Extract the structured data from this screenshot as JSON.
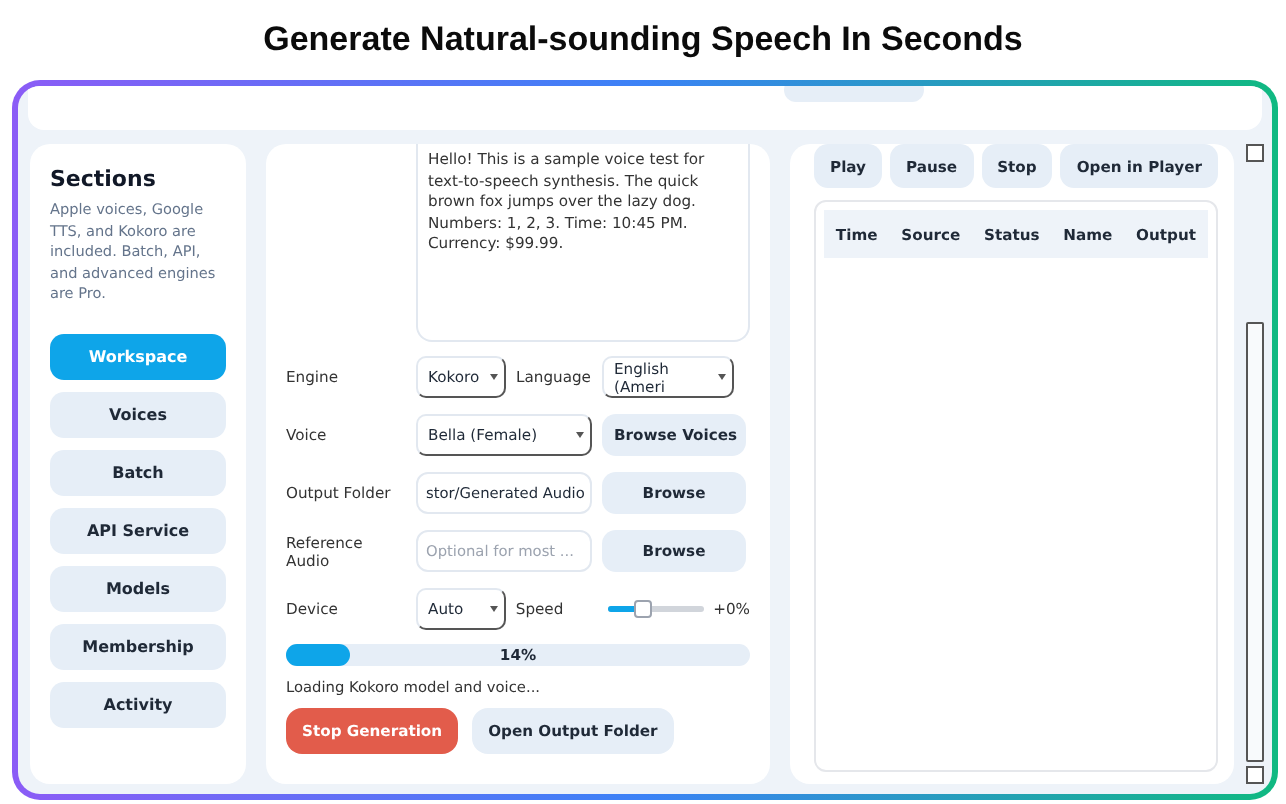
{
  "header": {
    "title": "Generate Natural-sounding Speech In Seconds"
  },
  "sidebar": {
    "title": "Sections",
    "description": "Apple voices, Google TTS, and Kokoro are included. Batch, API, and advanced engines are Pro.",
    "items": [
      {
        "label": "Workspace",
        "selected": true
      },
      {
        "label": "Voices",
        "selected": false
      },
      {
        "label": "Batch",
        "selected": false
      },
      {
        "label": "API Service",
        "selected": false
      },
      {
        "label": "Models",
        "selected": false
      },
      {
        "label": "Membership",
        "selected": false
      },
      {
        "label": "Activity",
        "selected": false
      }
    ]
  },
  "workspace": {
    "text": "Hello! This is a sample voice test for text-to-speech synthesis. The quick brown fox jumps over the lazy dog. Numbers: 1, 2, 3. Time: 10:45 PM. Currency: $99.99.",
    "rows": [
      {
        "kind": "select_pair",
        "label": "Engine",
        "value": "Kokoro",
        "second_label": "Language",
        "second_value": "English (Ameri"
      },
      {
        "kind": "select_button",
        "label": "Voice",
        "value": "Bella (Female)",
        "button": "Browse Voices"
      },
      {
        "kind": "input_button",
        "label": "Output Folder",
        "value": "stor/Generated Audio",
        "button": "Browse"
      },
      {
        "kind": "input_button",
        "label": "Reference Audio",
        "placeholder": "Optional for most ...",
        "button": "Browse"
      },
      {
        "kind": "select_slider",
        "label": "Device",
        "value": "Auto",
        "second_label": "Speed",
        "level": 0.35,
        "reading": "+0%"
      }
    ],
    "progress": {
      "level": 0.14,
      "reading": "14%"
    },
    "status": "Loading Kokoro model and voice...",
    "buttons": [
      {
        "label": "Stop Generation",
        "kind": "danger"
      },
      {
        "label": "Open Output Folder",
        "kind": "secondary"
      }
    ]
  },
  "player": {
    "buttons": [
      "Play",
      "Pause",
      "Stop",
      "Open in Player"
    ],
    "table": {
      "columns": [
        "Time",
        "Source",
        "Status",
        "Name",
        "Output"
      ]
    }
  }
}
